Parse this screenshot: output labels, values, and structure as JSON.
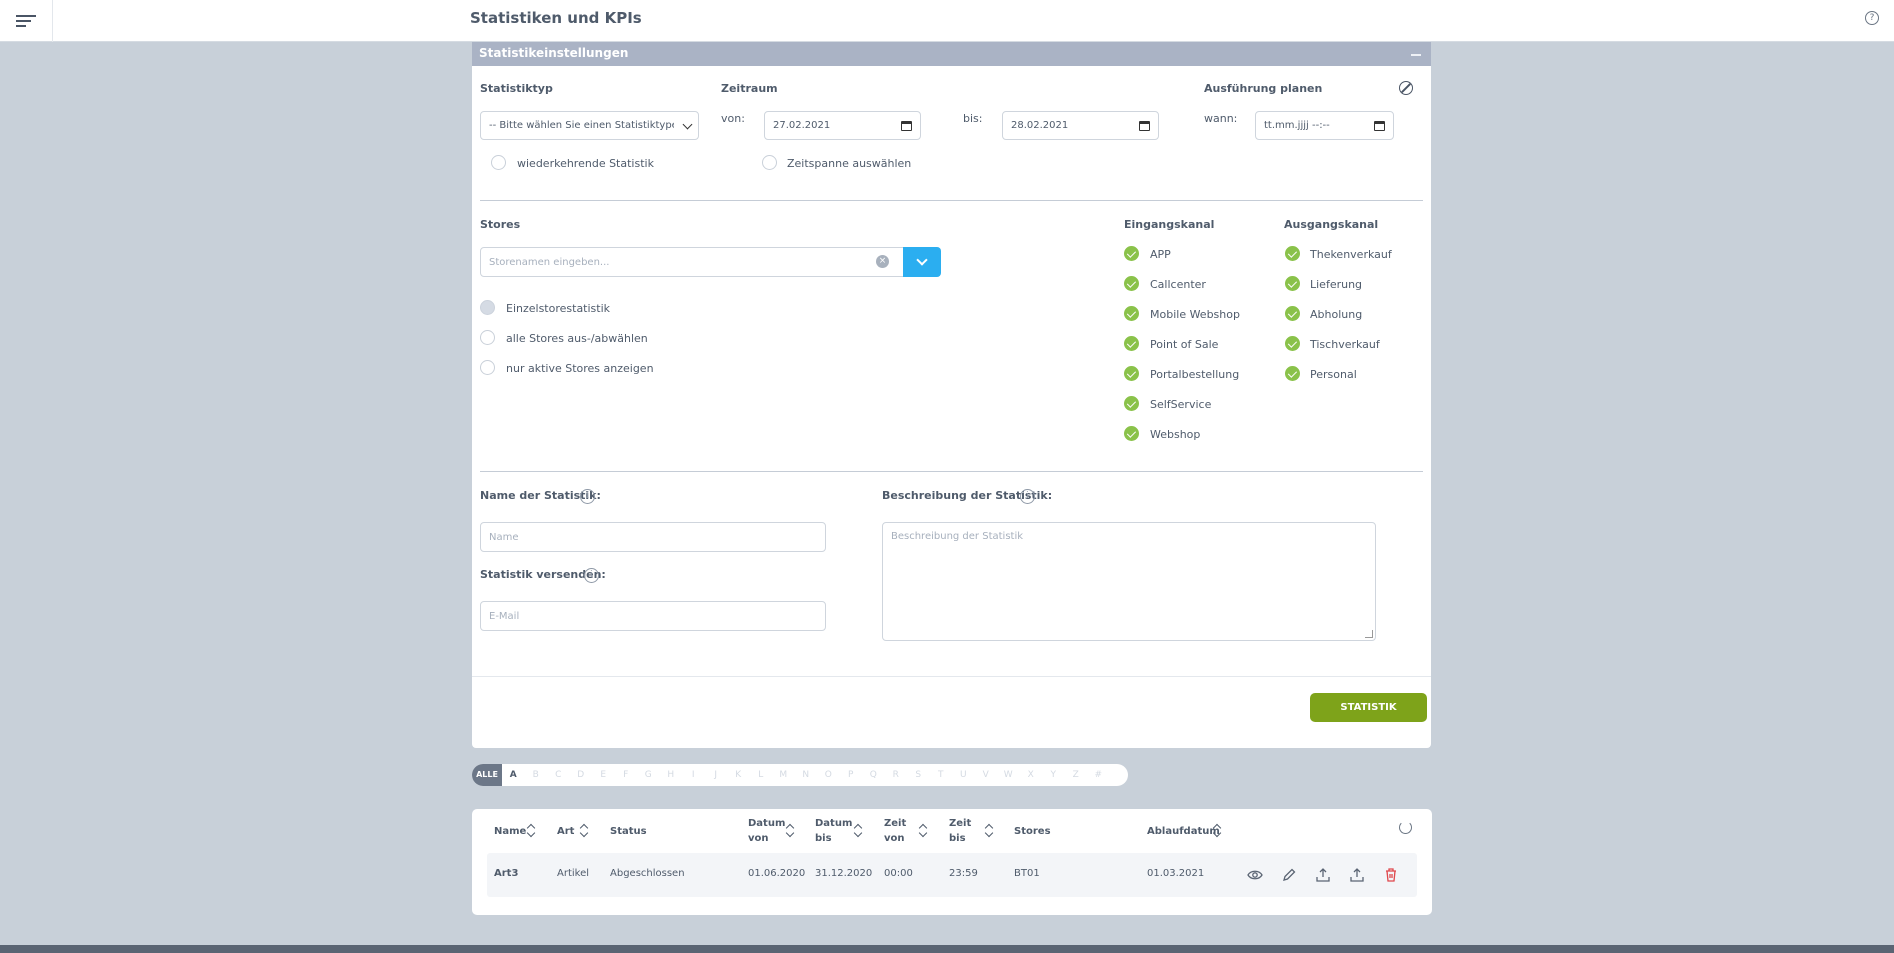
{
  "header": {
    "title": "Statistiken und KPIs"
  },
  "settings": {
    "panel_title": "Statistikeinstellungen",
    "type_label": "Statistiktyp",
    "type_select": "-- Bitte wählen Sie einen Statistiktypen --",
    "recurring_label": "wiederkehrende Statistik",
    "period_label": "Zeitraum",
    "from_label": "von:",
    "from_value": "27.02.2021",
    "to_label": "bis:",
    "to_value": "28.02.2021",
    "timespan_label": "Zeitspanne auswählen",
    "schedule_label": "Ausführung planen",
    "when_label": "wann:",
    "when_value": "tt.mm.jjjj --:--"
  },
  "stores": {
    "label": "Stores",
    "placeholder": "Storenamen eingeben...",
    "options": [
      "Einzelstorestatistik",
      "alle Stores aus-/abwählen",
      "nur aktive Stores anzeigen"
    ]
  },
  "incoming": {
    "label": "Eingangskanal",
    "items": [
      "APP",
      "Callcenter",
      "Mobile Webshop",
      "Point of Sale",
      "Portalbestellung",
      "SelfService",
      "Webshop"
    ]
  },
  "outgoing": {
    "label": "Ausgangskanal",
    "items": [
      "Thekenverkauf",
      "Lieferung",
      "Abholung",
      "Tischverkauf",
      "Personal"
    ]
  },
  "details": {
    "name_label": "Name der Statistik:",
    "name_placeholder": "Name",
    "send_label": "Statistik versenden:",
    "email_placeholder": "E-Mail",
    "desc_label": "Beschreibung der Statistik:",
    "desc_placeholder": "Beschreibung der Statistik",
    "create_button": "STATISTIK ERSTELLEN"
  },
  "alphabet": {
    "all": "ALLE",
    "letters": [
      "A",
      "B",
      "C",
      "D",
      "E",
      "F",
      "G",
      "H",
      "I",
      "J",
      "K",
      "L",
      "M",
      "N",
      "O",
      "P",
      "Q",
      "R",
      "S",
      "T",
      "U",
      "V",
      "W",
      "X",
      "Y",
      "Z",
      "#"
    ],
    "active": "A"
  },
  "table": {
    "headers": {
      "name": "Name",
      "art": "Art",
      "status": "Status",
      "datum_von": [
        "Datum",
        "von"
      ],
      "datum_bis": [
        "Datum",
        "bis"
      ],
      "zeit_von": [
        "Zeit",
        "von"
      ],
      "zeit_bis": [
        "Zeit",
        "bis"
      ],
      "stores": "Stores",
      "ablauf": "Ablaufdatum"
    },
    "rows": [
      {
        "name": "Art3",
        "art": "Artikel",
        "status": "Abgeschlossen",
        "datum_von": "01.06.2020",
        "datum_bis": "31.12.2020",
        "zeit_von": "00:00",
        "zeit_bis": "23:59",
        "stores": "BT01",
        "ablauf": "01.03.2021"
      }
    ]
  },
  "colors": {
    "accent_blue": "#2baef0",
    "check_green": "#8ac24a",
    "create_green": "#7ea31a",
    "delete_red": "#e0474c"
  }
}
